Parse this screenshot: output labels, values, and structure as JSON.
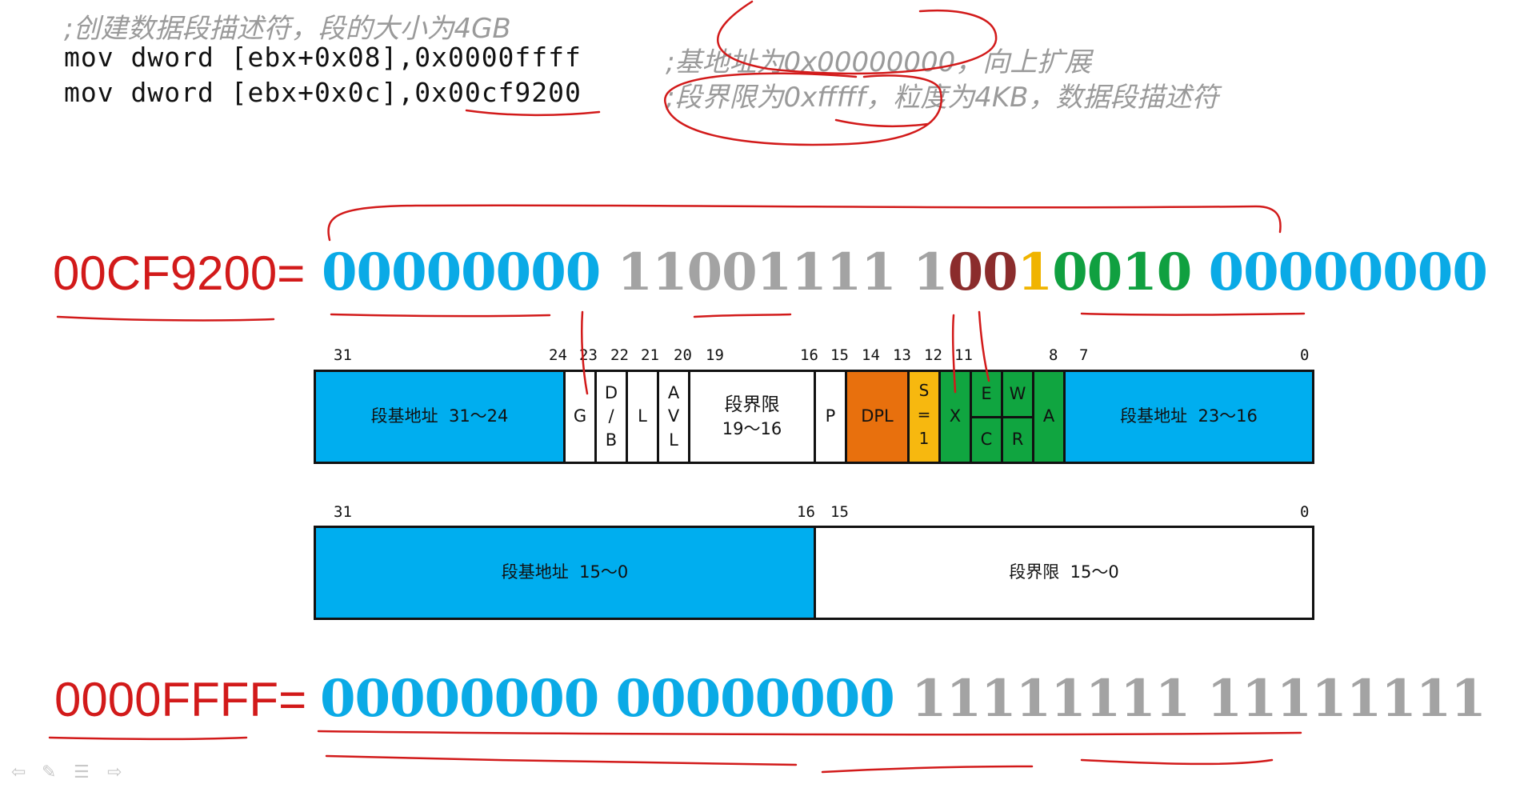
{
  "code": {
    "comment1": ";创建数据段描述符，段的大小为4GB",
    "line1": "mov dword [ebx+0x08],0x0000ffff",
    "line2": "mov dword [ebx+0x0c],0x00cf9200",
    "comment2": ";基地址为0x00000000，向上扩展",
    "comment3": ";段界限为0xfffff，粒度为4KB，数据段描述符"
  },
  "high_dword": {
    "label": "00CF9200=",
    "byte3": "00000000",
    "byte2": "11001111",
    "byte1_a": "1",
    "byte1_b": "00",
    "byte1_c": "1",
    "byte1_d": "0010",
    "byte0": "00000000"
  },
  "low_dword": {
    "label": "0000FFFF=",
    "byte3": "00000000",
    "byte2": "00000000",
    "byte1": "11111111",
    "byte0": "11111111"
  },
  "high_table": {
    "bit_numbers": [
      "31",
      "24",
      "23",
      "22",
      "21",
      "20",
      "19",
      "16",
      "15",
      "14",
      "13",
      "12",
      "11",
      "8",
      "7",
      "0"
    ],
    "base_hi_title": "段基地址",
    "base_hi_range": "31～24",
    "g": "G",
    "db_top": "D",
    "db_mid": "/",
    "db_bot": "B",
    "l": "L",
    "avl_a": "A",
    "avl_v": "V",
    "avl_l": "L",
    "limit_title": "段界限",
    "limit_range": "19～16",
    "p": "P",
    "dpl": "DPL",
    "s": "S=1",
    "x": "X",
    "e": "E",
    "w": "W",
    "c": "C",
    "r": "R",
    "a": "A",
    "base_mid_title": "段基地址",
    "base_mid_range": "23～16"
  },
  "low_table": {
    "bit_numbers": [
      "31",
      "16",
      "15",
      "0"
    ],
    "base_lo_title": "段基地址",
    "base_lo_range": "15～0",
    "limit_lo_title": "段界限",
    "limit_lo_range": "15～0"
  },
  "colors": {
    "blue": "#00aeef",
    "orange": "#e8700d",
    "yellow": "#f7b80f",
    "green": "#10a540",
    "red_ink": "#d21a1a"
  }
}
